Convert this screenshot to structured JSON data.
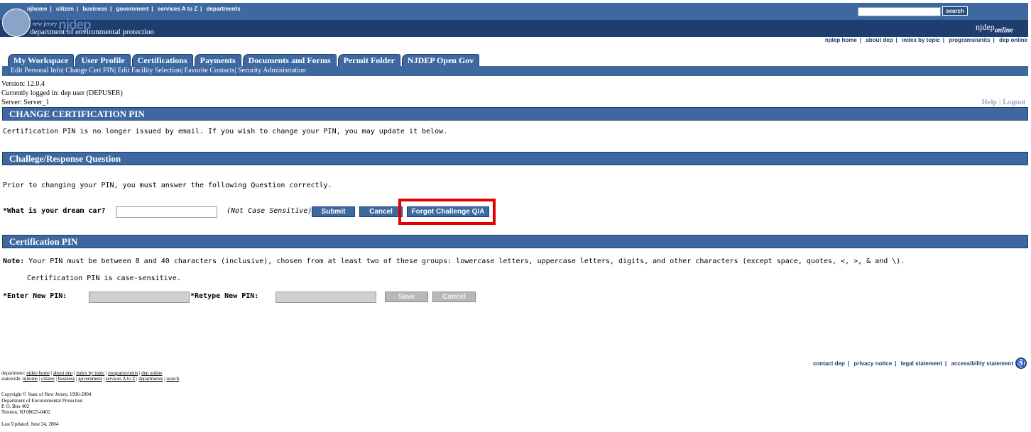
{
  "header": {
    "top_links": [
      "njhome",
      "citizen",
      "business",
      "government",
      "services A to Z",
      "departments"
    ],
    "search_button": "search",
    "logo_newjersey": "new jersey",
    "logo_njdep": "njdep",
    "logo_department": "department of environmental protection",
    "njdep_online_prefix": "njdep",
    "njdep_online_suffix": "online",
    "sub_links": [
      "njdep home",
      "about dep",
      "index by topic",
      "programs/units",
      "dep online"
    ]
  },
  "tabs": [
    "My Workspace",
    "User Profile",
    "Certifications",
    "Payments",
    "Documents and Forms",
    "Permit Folder",
    "NJDEP Open Gov"
  ],
  "subtabs": [
    "Edit Personal Info",
    "Change Cert PIN",
    "Edit Facility Selection",
    "Favorite Contacts",
    "Security Administration"
  ],
  "info": {
    "version": "Version: 12.0.4",
    "logged_in": "Currently logged in: dep user (DEPUSER)",
    "server": "Server: Server_1"
  },
  "help": "Help",
  "logout": "Logout",
  "sections": {
    "change_pin_title": "CHANGE CERTIFICATION PIN",
    "change_pin_text": "Certification PIN is no longer issued by email. If you wish to change your PIN, you may update it below.",
    "challenge_title": "Challege/Response Question",
    "challenge_text": "Prior to changing your PIN, you must answer the following Question correctly.",
    "question_label": "*What is your dream car?",
    "question_value": "",
    "not_case_sensitive": "(Not Case Sensitive)",
    "submit_label": "Submit",
    "cancel_label": "Cancel",
    "forgot_label": "Forgot Challenge Q/A",
    "cert_pin_title": "Certification PIN",
    "note_label": "Note:",
    "note_text": " Your PIN must be between 8 and 40 characters (inclusive), chosen from at least two of these groups: lowercase letters, uppercase letters, digits, and other characters (except space, quotes, <, >, & and \\).",
    "case_sensitive_text": "Certification PIN is case-sensitive.",
    "new_pin_label": "*Enter New PIN:",
    "retype_pin_label": "*Retype New PIN:",
    "save_label": "Save",
    "cancel2_label": "Cancel"
  },
  "footer": {
    "links": [
      "contact dep",
      "privacy notice",
      "legal statement",
      "accessibility statement"
    ],
    "department_prefix": "department: ",
    "department_links": [
      "njdep home",
      "about dep",
      "index by topic",
      "programs/units",
      "dep online"
    ],
    "statewide_prefix": "statewide: ",
    "statewide_links": [
      "njhome",
      "citizen",
      "business",
      "government",
      "services A to Z",
      "departments",
      "search"
    ],
    "copyright": "Copyright © State of New Jersey, 1996-2004",
    "address1": "Department of Environmental Protection",
    "address2": "P. O. Box 402",
    "address3": "Trenton, NJ 08625-0402",
    "last_updated": "Last Updated: June 24, 2004"
  }
}
